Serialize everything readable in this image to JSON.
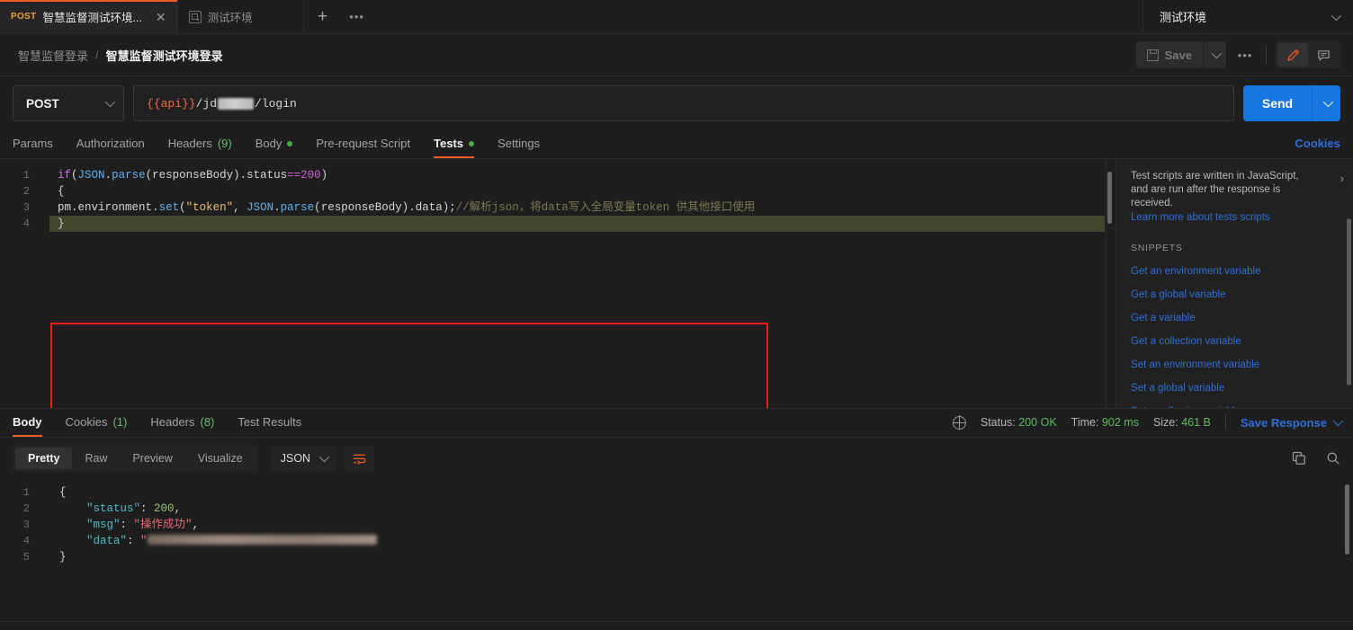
{
  "accent": {
    "orange": "#ef5b25",
    "blue": "#1776e0",
    "link_blue": "#2f6fd8",
    "green": "#5fb85f",
    "red_box": "#ee1b21",
    "method_orange": "#e8a33d"
  },
  "tabbar": {
    "tabs": [
      {
        "method": "POST",
        "title": "智慧监督测试环境...",
        "active": true,
        "close_icon": "close-icon"
      },
      {
        "method": "",
        "title": "测试环境",
        "active": false,
        "icon": "environment-icon"
      }
    ],
    "add_label": "+",
    "more_label": "•••",
    "environment": {
      "name": "测试环境",
      "caret": "chevron-down-icon"
    }
  },
  "header": {
    "breadcrumb": {
      "parent": "智慧监督登录",
      "separator": "/",
      "current": "智慧监督测试环境登录"
    },
    "save_label": "Save",
    "save_caret": "chevron-down-icon",
    "more_label": "•••",
    "edit_icon": "pencil-icon",
    "comment_icon": "comment-icon"
  },
  "url_bar": {
    "method": "POST",
    "method_caret": "chevron-down-icon",
    "url_prefix": "{{api}}",
    "url_mid": "/jd",
    "url_suffix": "/login",
    "url_full": "{{api}}/jd[redacted]/login",
    "send_label": "Send",
    "send_caret": "chevron-down-icon"
  },
  "request_tabs": {
    "items": [
      {
        "label": "Params",
        "active": false
      },
      {
        "label": "Authorization",
        "active": false
      },
      {
        "label": "Headers",
        "count": "(9)",
        "active": false
      },
      {
        "label": "Body",
        "dot": true,
        "active": false
      },
      {
        "label": "Pre-request Script",
        "active": false
      },
      {
        "label": "Tests",
        "dot": true,
        "active": true
      },
      {
        "label": "Settings",
        "active": false
      }
    ],
    "cookies_link": "Cookies"
  },
  "editor": {
    "line_numbers": [
      "1",
      "2",
      "3",
      "4"
    ],
    "active_line": 4,
    "code_lines": [
      {
        "n": 1,
        "tokens": [
          {
            "t": "if",
            "c": "k-key"
          },
          {
            "t": "(",
            "c": "k-plain"
          },
          {
            "t": "JSON",
            "c": "k-fn"
          },
          {
            "t": ".",
            "c": "k-plain"
          },
          {
            "t": "parse",
            "c": "k-fn"
          },
          {
            "t": "(",
            "c": "k-plain"
          },
          {
            "t": "responseBody",
            "c": "k-prop"
          },
          {
            "t": ").",
            "c": "k-plain"
          },
          {
            "t": "status",
            "c": "k-plain"
          },
          {
            "t": "==",
            "c": "k-op"
          },
          {
            "t": "200",
            "c": "k-num"
          },
          {
            "t": ")",
            "c": "k-plain"
          }
        ]
      },
      {
        "n": 2,
        "tokens": [
          {
            "t": "{",
            "c": "k-brace"
          }
        ]
      },
      {
        "n": 3,
        "tokens": [
          {
            "t": "pm",
            "c": "k-plain"
          },
          {
            "t": ".",
            "c": "k-plain"
          },
          {
            "t": "environment",
            "c": "k-plain"
          },
          {
            "t": ".",
            "c": "k-plain"
          },
          {
            "t": "set",
            "c": "k-fn"
          },
          {
            "t": "(",
            "c": "k-plain"
          },
          {
            "t": "\"token\"",
            "c": "k-str"
          },
          {
            "t": ", ",
            "c": "k-plain"
          },
          {
            "t": "JSON",
            "c": "k-fn"
          },
          {
            "t": ".",
            "c": "k-plain"
          },
          {
            "t": "parse",
            "c": "k-fn"
          },
          {
            "t": "(",
            "c": "k-plain"
          },
          {
            "t": "responseBody",
            "c": "k-prop"
          },
          {
            "t": ").",
            "c": "k-plain"
          },
          {
            "t": "data",
            "c": "k-plain"
          },
          {
            "t": ");",
            "c": "k-plain"
          },
          {
            "t": "//解析json，将data写入全局变量token 供其他接口使用",
            "c": "k-com"
          }
        ]
      },
      {
        "n": 4,
        "tokens": [
          {
            "t": "}",
            "c": "k-brace"
          }
        ]
      }
    ],
    "raw_code": "if(JSON.parse(responseBody).status==200)\n{\npm.environment.set(\"token\", JSON.parse(responseBody).data);//解析json，将data写入全局变量token 供其他接口使用\n}"
  },
  "snippets": {
    "intro": "Test scripts are written in JavaScript, and are run after the response is received.",
    "learn_more": "Learn more about tests scripts",
    "collapse_icon": "chevron-right-icon",
    "section_title": "SNIPPETS",
    "items": [
      "Get an environment variable",
      "Get a global variable",
      "Get a variable",
      "Get a collection variable",
      "Set an environment variable",
      "Set a global variable",
      "Set a collection variable"
    ]
  },
  "response": {
    "tabs": [
      {
        "label": "Body",
        "active": true
      },
      {
        "label": "Cookies",
        "count": "(1)",
        "active": false
      },
      {
        "label": "Headers",
        "count": "(8)",
        "active": false
      },
      {
        "label": "Test Results",
        "active": false
      }
    ],
    "meta": {
      "globe_icon": "globe-icon",
      "status_label": "Status:",
      "status_value": "200 OK",
      "time_label": "Time:",
      "time_value": "902 ms",
      "size_label": "Size:",
      "size_value": "461 B"
    },
    "save_response": "Save Response",
    "save_response_caret": "chevron-down-icon",
    "toolbar": {
      "formats": [
        {
          "label": "Pretty",
          "selected": true
        },
        {
          "label": "Raw",
          "selected": false
        },
        {
          "label": "Preview",
          "selected": false
        },
        {
          "label": "Visualize",
          "selected": false
        }
      ],
      "language": "JSON",
      "language_caret": "chevron-down-icon",
      "wrap_icon": "word-wrap-icon",
      "copy_icon": "copy-icon",
      "search_icon": "search-icon"
    },
    "body": {
      "line_numbers": [
        "1",
        "2",
        "3",
        "4",
        "5"
      ],
      "lines": [
        {
          "n": 1,
          "tokens": [
            {
              "t": "{",
              "c": "j-brace"
            }
          ]
        },
        {
          "n": 2,
          "tokens": [
            {
              "t": "    ",
              "c": "j-p"
            },
            {
              "t": "\"status\"",
              "c": "j-key"
            },
            {
              "t": ": ",
              "c": "j-p"
            },
            {
              "t": "200",
              "c": "j-num"
            },
            {
              "t": ",",
              "c": "j-p"
            }
          ]
        },
        {
          "n": 3,
          "tokens": [
            {
              "t": "    ",
              "c": "j-p"
            },
            {
              "t": "\"msg\"",
              "c": "j-key"
            },
            {
              "t": ": ",
              "c": "j-p"
            },
            {
              "t": "\"操作成功\"",
              "c": "j-str"
            },
            {
              "t": ",",
              "c": "j-p"
            }
          ]
        },
        {
          "n": 4,
          "tokens": [
            {
              "t": "    ",
              "c": "j-p"
            },
            {
              "t": "\"data\"",
              "c": "j-key"
            },
            {
              "t": ": ",
              "c": "j-p"
            },
            {
              "t": "\"",
              "c": "j-str"
            },
            {
              "t": "__BLUR__",
              "c": "j-str"
            }
          ]
        },
        {
          "n": 5,
          "tokens": [
            {
              "t": "}",
              "c": "j-brace"
            }
          ]
        }
      ],
      "raw": "{\n    \"status\": 200,\n    \"msg\": \"操作成功\",\n    \"data\": \"[redacted token]\"\n}"
    }
  }
}
